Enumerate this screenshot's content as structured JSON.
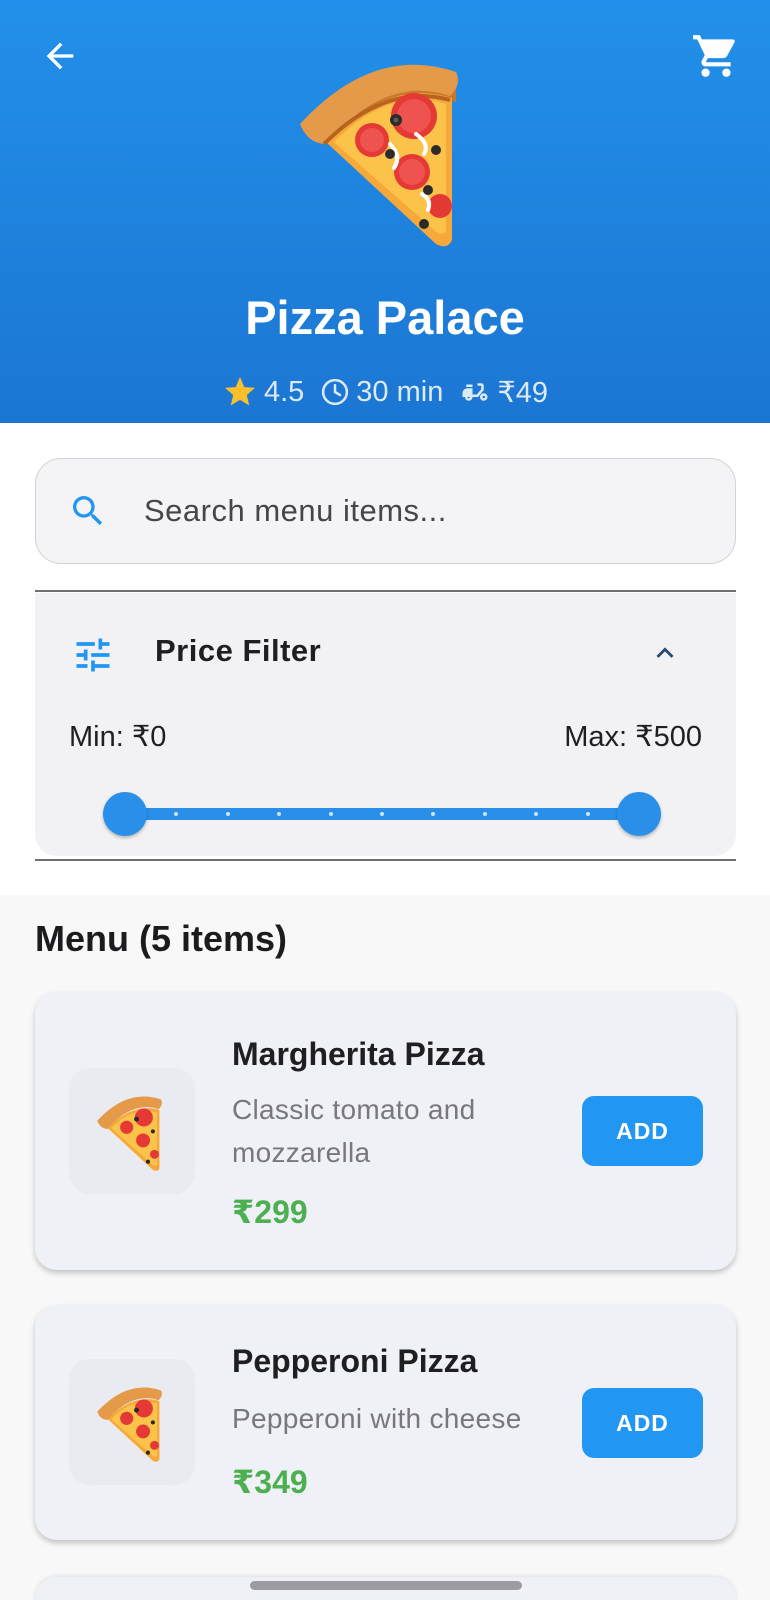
{
  "header": {
    "restaurant_name": "Pizza Palace",
    "rating": "4.5",
    "delivery_time": "30 min",
    "delivery_fee": "₹49",
    "hero_icon": "pizza-slice-icon",
    "colors": {
      "top": "#2290ea",
      "bottom": "#1b76d2"
    }
  },
  "search": {
    "placeholder": "Search menu items..."
  },
  "price_filter": {
    "title": "Price Filter",
    "min_label": "Min: ₹0",
    "max_label": "Max: ₹500",
    "range_min": 0,
    "range_max": 500,
    "selected_min": 0,
    "selected_max": 500,
    "divisions": 10
  },
  "menu": {
    "title": "Menu (5 items)",
    "items": [
      {
        "name": "Margherita Pizza",
        "description": "Classic tomato and mozzarella",
        "price": "₹299",
        "add_label": "ADD"
      },
      {
        "name": "Pepperoni Pizza",
        "description": "Pepperoni with cheese",
        "price": "₹349",
        "add_label": "ADD"
      }
    ]
  },
  "colors": {
    "accent": "#2196f3",
    "price": "#4caf50"
  }
}
